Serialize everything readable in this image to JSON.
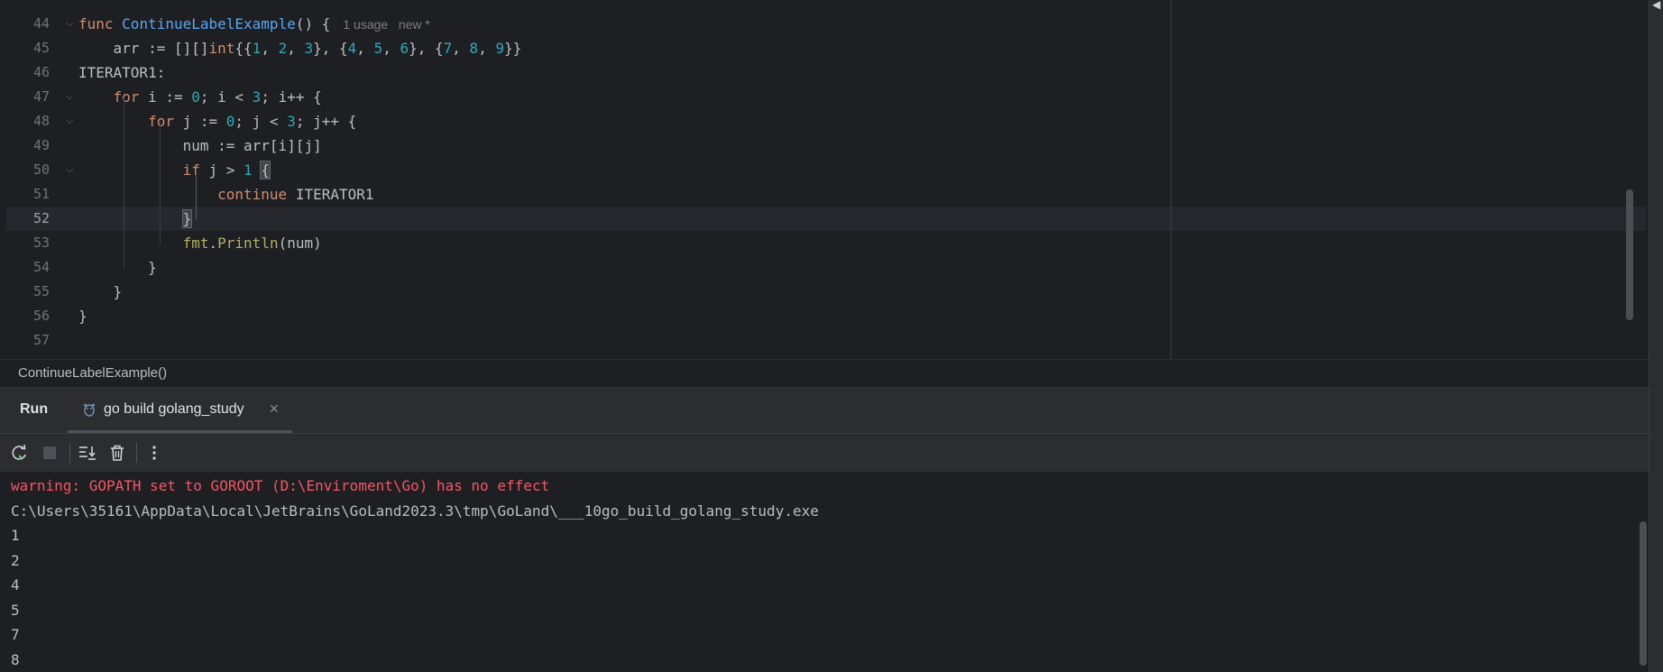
{
  "editor": {
    "lines": [
      {
        "no": "44",
        "segments": [
          {
            "t": "func ",
            "c": "kw"
          },
          {
            "t": "ContinueLabelExample",
            "c": "fn"
          },
          {
            "t": "() {",
            "c": ""
          }
        ],
        "hint": "1 usage   new *",
        "fold": true
      },
      {
        "no": "45",
        "segments": [
          {
            "t": "    arr := [][]",
            "c": ""
          },
          {
            "t": "int",
            "c": "kw"
          },
          {
            "t": "{{",
            "c": ""
          },
          {
            "t": "1",
            "c": "num"
          },
          {
            "t": ", ",
            "c": ""
          },
          {
            "t": "2",
            "c": "num"
          },
          {
            "t": ", ",
            "c": ""
          },
          {
            "t": "3",
            "c": "num"
          },
          {
            "t": "}, {",
            "c": ""
          },
          {
            "t": "4",
            "c": "num"
          },
          {
            "t": ", ",
            "c": ""
          },
          {
            "t": "5",
            "c": "num"
          },
          {
            "t": ", ",
            "c": ""
          },
          {
            "t": "6",
            "c": "num"
          },
          {
            "t": "}, {",
            "c": ""
          },
          {
            "t": "7",
            "c": "num"
          },
          {
            "t": ", ",
            "c": ""
          },
          {
            "t": "8",
            "c": "num"
          },
          {
            "t": ", ",
            "c": ""
          },
          {
            "t": "9",
            "c": "num"
          },
          {
            "t": "}}",
            "c": ""
          }
        ]
      },
      {
        "no": "46",
        "segments": [
          {
            "t": "ITERATOR1:",
            "c": ""
          }
        ]
      },
      {
        "no": "47",
        "segments": [
          {
            "t": "    ",
            "c": ""
          },
          {
            "t": "for",
            "c": "kw"
          },
          {
            "t": " i := ",
            "c": ""
          },
          {
            "t": "0",
            "c": "num"
          },
          {
            "t": "; i < ",
            "c": ""
          },
          {
            "t": "3",
            "c": "num"
          },
          {
            "t": "; i++ {",
            "c": ""
          }
        ],
        "fold": true
      },
      {
        "no": "48",
        "segments": [
          {
            "t": "        ",
            "c": ""
          },
          {
            "t": "for",
            "c": "kw"
          },
          {
            "t": " j := ",
            "c": ""
          },
          {
            "t": "0",
            "c": "num"
          },
          {
            "t": "; j < ",
            "c": ""
          },
          {
            "t": "3",
            "c": "num"
          },
          {
            "t": "; j++ {",
            "c": ""
          }
        ],
        "fold": true
      },
      {
        "no": "49",
        "segments": [
          {
            "t": "            num := arr[i][j]",
            "c": ""
          }
        ]
      },
      {
        "no": "50",
        "segments": [
          {
            "t": "            ",
            "c": ""
          },
          {
            "t": "if",
            "c": "kw"
          },
          {
            "t": " j > ",
            "c": ""
          },
          {
            "t": "1",
            "c": "num"
          },
          {
            "t": " ",
            "c": ""
          },
          {
            "t": "{",
            "c": "brace-hl"
          }
        ],
        "fold": true
      },
      {
        "no": "51",
        "segments": [
          {
            "t": "                ",
            "c": ""
          },
          {
            "t": "continue",
            "c": "kw"
          },
          {
            "t": " ITERATOR1",
            "c": ""
          }
        ]
      },
      {
        "no": "52",
        "segments": [
          {
            "t": "            ",
            "c": ""
          },
          {
            "t": "}",
            "c": "brace-hl"
          }
        ],
        "current": true
      },
      {
        "no": "53",
        "segments": [
          {
            "t": "            ",
            "c": ""
          },
          {
            "t": "fmt",
            "c": "call"
          },
          {
            "t": ".",
            "c": ""
          },
          {
            "t": "Println",
            "c": "call"
          },
          {
            "t": "(num)",
            "c": ""
          }
        ]
      },
      {
        "no": "54",
        "segments": [
          {
            "t": "        }",
            "c": ""
          }
        ]
      },
      {
        "no": "55",
        "segments": [
          {
            "t": "    }",
            "c": ""
          }
        ]
      },
      {
        "no": "56",
        "segments": [
          {
            "t": "}",
            "c": ""
          }
        ]
      },
      {
        "no": "57",
        "segments": []
      }
    ]
  },
  "breadcrumb": {
    "label": "ContinueLabelExample()"
  },
  "run_panel": {
    "title": "Run",
    "tab": {
      "label": "go build golang_study",
      "icon": "go-gopher-icon"
    },
    "toolbar": [
      "rerun-icon",
      "stop-icon",
      "scroll-to-end-icon",
      "clear-all-icon",
      "more-options-icon"
    ]
  },
  "console": {
    "lines": [
      {
        "text": "warning: GOPATH set to GOROOT (D:\\Enviroment\\Go) has no effect",
        "type": "err"
      },
      {
        "text": "C:\\Users\\35161\\AppData\\Local\\JetBrains\\GoLand2023.3\\tmp\\GoLand\\___10go_build_golang_study.exe",
        "type": "out"
      },
      {
        "text": "1",
        "type": "out"
      },
      {
        "text": "2",
        "type": "out"
      },
      {
        "text": "4",
        "type": "out"
      },
      {
        "text": "5",
        "type": "out"
      },
      {
        "text": "7",
        "type": "out"
      },
      {
        "text": "8",
        "type": "out"
      }
    ]
  },
  "colors": {
    "background": "#1e1f22",
    "panel": "#2b2d30",
    "keyword": "#cf8e6d",
    "function": "#56a8f5",
    "number": "#2aacb8",
    "error": "#f75464"
  }
}
